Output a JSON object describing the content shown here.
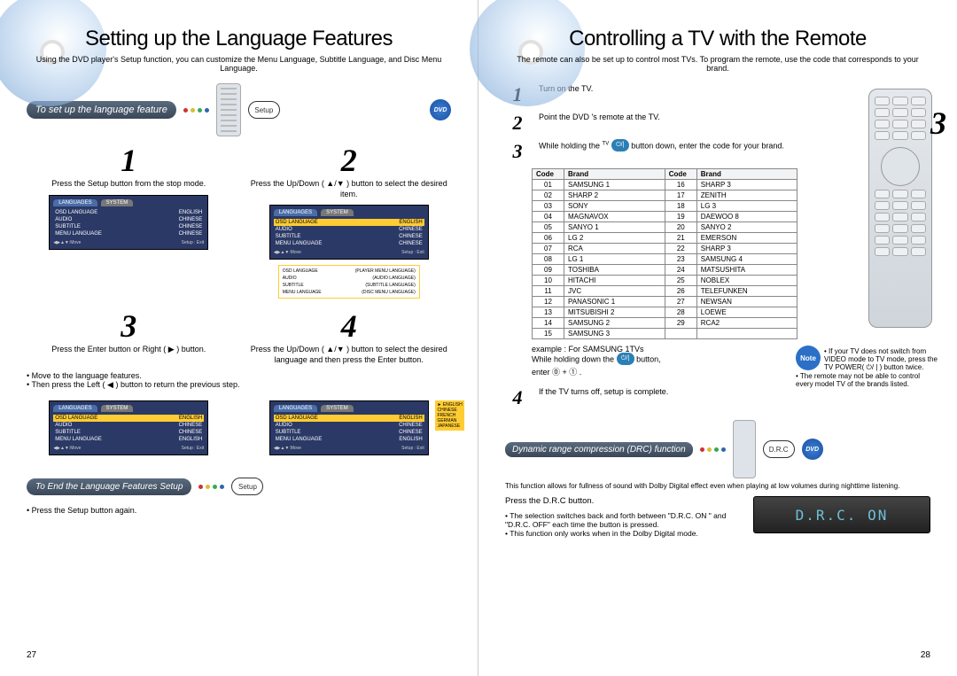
{
  "left": {
    "title": "Setting up the Language Features",
    "intro": "Using the DVD player's Setup function, you can customize the Menu Language, Subtitle Language, and Disc Menu Language.",
    "banner": "To set up the language feature",
    "setup_chip": "Setup",
    "dvd_badge": "DVD",
    "cells": {
      "1": {
        "num": "1",
        "text": "Press the Setup button from the stop mode."
      },
      "2": {
        "num": "2",
        "text": "Press the Up/Down ( ▲/▼ ) button to select the desired item."
      },
      "3": {
        "num": "3",
        "text": "Press the Enter button or Right ( ▶ ) button."
      },
      "4": {
        "num": "4",
        "text": "Press the Up/Down ( ▲/▼ ) button to select the desired language and then press the Enter button."
      }
    },
    "mid_bullets": [
      "Move to the language features.",
      "Then press the Left ( ◀ ) button to return the previous step."
    ],
    "osd_tabs": {
      "a": "LANGUAGES",
      "b": "SYSTEM"
    },
    "osd_rows": [
      {
        "k": "OSD LANGUAGE",
        "v": "ENGLISH"
      },
      {
        "k": "AUDIO",
        "v": "CHINESE"
      },
      {
        "k": "SUBTITLE",
        "v": "CHINESE"
      },
      {
        "k": "MENU LANGUAGE",
        "v": "CHINESE"
      }
    ],
    "osd_foot_move": "◀▶▲▼:Move",
    "osd_foot_exit": "Setup : Exit",
    "popup_rows": [
      {
        "k": "OSD LANGUAGE",
        "v": "(PLAYER MENU LANGUAGE)"
      },
      {
        "k": "AUDIO",
        "v": "(AUDIO LANGUAGE)"
      },
      {
        "k": "SUBTITLE",
        "v": "(SUBTITLE LANGUAGE)"
      },
      {
        "k": "MENU LANGUAGE",
        "v": "(DISC MENU LANGUAGE)"
      }
    ],
    "osd_rows_3": [
      {
        "k": "OSD LANGUAGE",
        "v": "ENGLISH",
        "hl": true
      },
      {
        "k": "AUDIO",
        "v": "CHINESE"
      },
      {
        "k": "SUBTITLE",
        "v": "CHINESE"
      },
      {
        "k": "MENU LANGUAGE",
        "v": "ENGLISH"
      }
    ],
    "side_langs": [
      "► ENGLISH",
      "CHINESE",
      "FRENCH",
      "GERMAN",
      "JAPANESE"
    ],
    "end_banner": "To End the Language Features Setup",
    "end_bullet": "Press the Setup button again.",
    "pagenum": "27"
  },
  "right": {
    "title": "Controlling a TV with the Remote",
    "intro": "The remote can also be set up to control most TVs. To program the remote, use the code that corresponds to your brand.",
    "steps": {
      "1": {
        "num": "1",
        "text": "Turn on the TV."
      },
      "2": {
        "num": "2",
        "text": "Point the DVD 's remote at the TV."
      },
      "3": {
        "num": "3",
        "text_a": "While holding the ",
        "text_b": " button down, enter the code for your brand.",
        "tv_label": "TV"
      },
      "4": {
        "num": "4",
        "text": "If the TV turns off, setup is complete."
      }
    },
    "big3": "3",
    "table_headers": {
      "code": "Code",
      "brand": "Brand"
    },
    "codes": [
      {
        "c": "01",
        "b": "SAMSUNG 1",
        "c2": "16",
        "b2": "SHARP 3"
      },
      {
        "c": "02",
        "b": "SHARP 2",
        "c2": "17",
        "b2": "ZENITH"
      },
      {
        "c": "03",
        "b": "SONY",
        "c2": "18",
        "b2": "LG 3"
      },
      {
        "c": "04",
        "b": "MAGNAVOX",
        "c2": "19",
        "b2": "DAEWOO 8"
      },
      {
        "c": "05",
        "b": "SANYO 1",
        "c2": "20",
        "b2": "SANYO 2"
      },
      {
        "c": "06",
        "b": "LG 2",
        "c2": "21",
        "b2": "EMERSON"
      },
      {
        "c": "07",
        "b": "RCA",
        "c2": "22",
        "b2": "SHARP 3"
      },
      {
        "c": "08",
        "b": "LG 1",
        "c2": "23",
        "b2": "SAMSUNG 4"
      },
      {
        "c": "09",
        "b": "TOSHIBA",
        "c2": "24",
        "b2": "MATSUSHITA"
      },
      {
        "c": "10",
        "b": "HITACHI",
        "c2": "25",
        "b2": "NOBLEX"
      },
      {
        "c": "11",
        "b": "JVC",
        "c2": "26",
        "b2": "TELEFUNKEN"
      },
      {
        "c": "12",
        "b": "PANASONIC 1",
        "c2": "27",
        "b2": "NEWSAN"
      },
      {
        "c": "13",
        "b": "MITSUBISHI 2",
        "c2": "28",
        "b2": "LOEWE"
      },
      {
        "c": "14",
        "b": "SAMSUNG 2",
        "c2": "29",
        "b2": "RCA2"
      },
      {
        "c": "15",
        "b": "SAMSUNG 3",
        "c2": "",
        "b2": ""
      }
    ],
    "example_lead": "example  : For SAMSUNG 1TVs",
    "example_hold": "While holding down the ",
    "example_button": " button,",
    "example_enter": "enter ⓪ + ① .",
    "note_badge": "Note",
    "note_items": [
      "If your TV does not switch from VIDEO mode to TV mode, press the TV POWER( ⏻/ | ) button twice.",
      "The remote may not be able to control every model TV of the brands listed."
    ],
    "drc": {
      "banner": "Dynamic range compression (DRC) function",
      "desc": "This function allows for fullness of sound with Dolby Digital effect even when playing at low volumes during nighttime listening.",
      "press": "Press the D.R.C button.",
      "bullets": [
        "The selection switches back and forth between \"D.R.C. ON \" and \"D.R.C. OFF\" each time the button is pressed.",
        "This function only works when in the Dolby Digital mode."
      ],
      "chip": "D.R.C",
      "dvd_badge": "DVD",
      "lcd": "D.R.C.  ON"
    },
    "pagenum": "28"
  }
}
